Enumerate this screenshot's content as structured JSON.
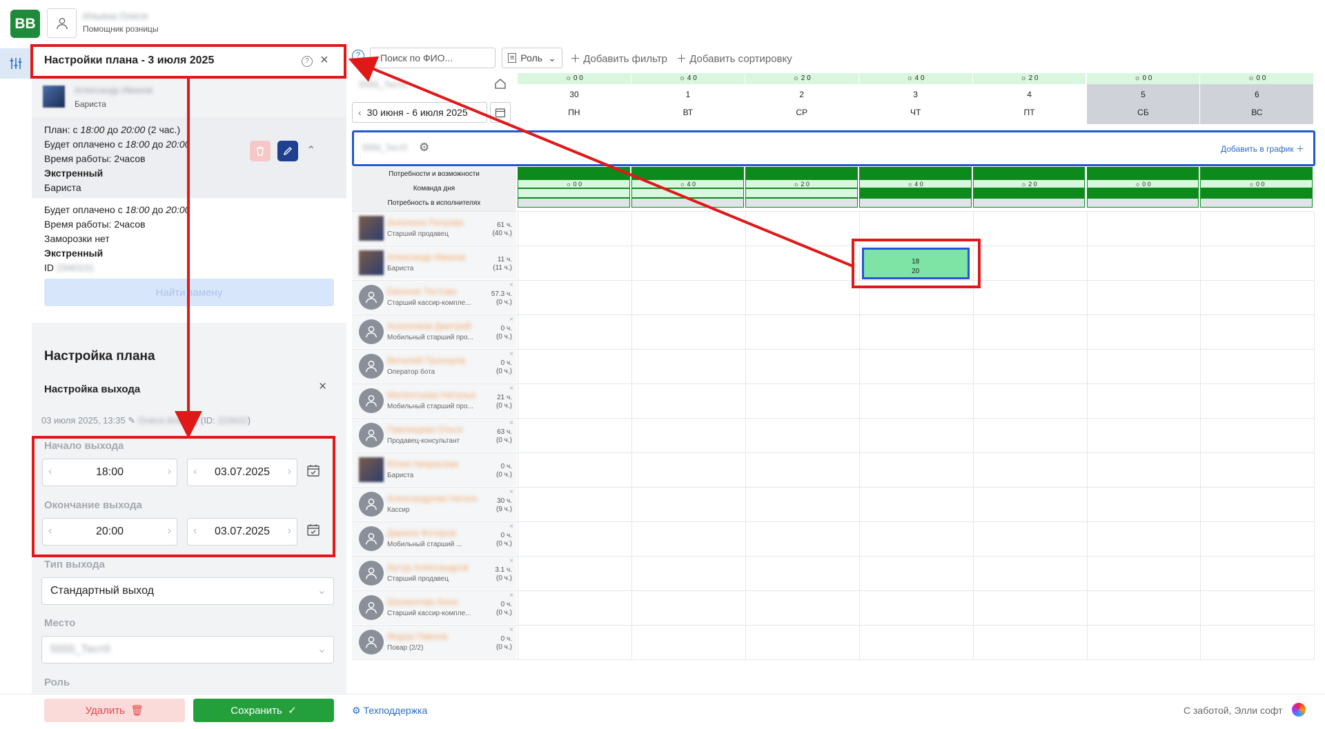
{
  "app": {
    "logo_text": "BB",
    "user_name": "Ильина Олеся",
    "user_role": "Помощник розницы"
  },
  "panel": {
    "title": "Настройки плана - 3 июля 2025",
    "employee": {
      "name": "Александр Иванов",
      "role": "Бариста"
    },
    "plan_block": {
      "plan_line_prefix": "План: с ",
      "plan_from": "18:00",
      "plan_to_word": " до ",
      "plan_to": "20:00",
      "plan_hours": " (2 час.)",
      "paid_prefix": "Будет оплачено с ",
      "paid_from": "18:00",
      "paid_to": "20:00",
      "work_time": "Время работы: 2часов",
      "urgent": "Экстренный",
      "role": "Бариста"
    },
    "fact_block": {
      "paid_prefix": "Будет оплачено с ",
      "paid_from": "18:00",
      "paid_to": "20:00",
      "work_time": "Время работы: 2часов",
      "freeze": "Заморозки нет",
      "urgent": "Экстренный",
      "id_label": "ID",
      "id_value": "2340101"
    },
    "find_replacement": "Найти замену",
    "settings_title": "Настройка плана",
    "exit_settings": "Настройка выхода",
    "meta_date": "03 июля 2025, 13:35",
    "meta_author": "Олеся Ильина",
    "meta_id_prefix": "(ID: ",
    "meta_id": "223410",
    "meta_id_suffix": ")",
    "start_label": "Начало выхода",
    "start_time": "18:00",
    "start_date": "03.07.2025",
    "end_label": "Окончание выхода",
    "end_time": "20:00",
    "end_date": "03.07.2025",
    "type_label": "Тип выхода",
    "type_value": "Стандартный выход",
    "place_label": "Место",
    "place_value": "5555_Тест0",
    "role_label": "Роль",
    "delete_label": "Удалить",
    "save_label": "Сохранить"
  },
  "toolbar": {
    "search_placeholder": "Поиск по ФИО...",
    "role_label": "Роль",
    "add_filter": "Добавить фильтр",
    "add_sort": "Добавить сортировку"
  },
  "store": {
    "name": "5555_Тест0",
    "week_range": "30 июня - 6 июля 2025"
  },
  "days": [
    {
      "weather": "0 0",
      "num": "30",
      "dow": "ПН",
      "weekend": false
    },
    {
      "weather": "4 0",
      "num": "1",
      "dow": "ВТ",
      "weekend": false
    },
    {
      "weather": "2 0",
      "num": "2",
      "dow": "СР",
      "weekend": false
    },
    {
      "weather": "4 0",
      "num": "3",
      "dow": "ЧТ",
      "weekend": false
    },
    {
      "weather": "2 0",
      "num": "4",
      "dow": "ПТ",
      "weekend": false
    },
    {
      "weather": "0 0",
      "num": "5",
      "dow": "СБ",
      "weekend": true
    },
    {
      "weather": "0 0",
      "num": "6",
      "dow": "ВС",
      "weekend": true
    }
  ],
  "store_row": {
    "name": "5555_Тест0",
    "add_to_schedule": "Добавить в график"
  },
  "needs": {
    "row1": "Потребности и возможности",
    "row2": "Команда дня",
    "row3": "Потребность в исполнителях",
    "values": [
      "0 0",
      "4 0",
      "2 0",
      "4 0",
      "2 0",
      "0 0",
      "0 0"
    ]
  },
  "employees": [
    {
      "name": "Ангелина Петрова",
      "role": "Старший продавец",
      "hours": "61 ч.",
      "sub": "(40 ч.)",
      "photo": true
    },
    {
      "name": "Александр Иванов",
      "role": "Бариста",
      "hours": "11 ч.",
      "sub": "(11 ч.)",
      "photo": true
    },
    {
      "name": "Евгения Тестова",
      "role": "Старший кассир-компле...",
      "hours": "57.3 ч.",
      "sub": "(0 ч.)",
      "photo": false
    },
    {
      "name": "Агрономов Дмитрий",
      "role": "Мобильный старший про...",
      "hours": "0 ч.",
      "sub": "(0 ч.)",
      "photo": false
    },
    {
      "name": "Виталий Прохоров",
      "role": "Оператор бота",
      "hours": "0 ч.",
      "sub": "(0 ч.)",
      "photo": false
    },
    {
      "name": "Мелентьева Наталья",
      "role": "Мобильный старший про...",
      "hours": "21 ч.",
      "sub": "(0 ч.)",
      "photo": false
    },
    {
      "name": "Павлищева Ольга",
      "role": "Продавец-консультант",
      "hours": "63 ч.",
      "sub": "(0 ч.)",
      "photo": false
    },
    {
      "name": "Юлия Некрасова",
      "role": "Бариста",
      "hours": "0 ч.",
      "sub": "(0 ч.)",
      "photo": true
    },
    {
      "name": "Александрова Наталья",
      "role": "Кассир",
      "hours": "30 ч.",
      "sub": "(9 ч.)",
      "photo": false
    },
    {
      "name": "Дарина Фоторов",
      "role": "Мобильный старший ...",
      "hours": "0 ч.",
      "sub": "(0 ч.)",
      "photo": false
    },
    {
      "name": "Артур Александров",
      "role": "Старший продавец",
      "hours": "3.1 ч.",
      "sub": "(0 ч.)",
      "photo": false
    },
    {
      "name": "Шахматова Анна",
      "role": "Старший кассир-компле...",
      "hours": "0 ч.",
      "sub": "(0 ч.)",
      "photo": false
    },
    {
      "name": "Федор Павлов",
      "role": "Повар (2/2)",
      "hours": "0 ч.",
      "sub": "(0 ч.)",
      "photo": false
    }
  ],
  "shift": {
    "start": "18",
    "end": "20",
    "day_index": 3,
    "employee_index": 1
  },
  "footer": {
    "support": "Техподдержка",
    "credit": "С заботой, Элли софт"
  }
}
